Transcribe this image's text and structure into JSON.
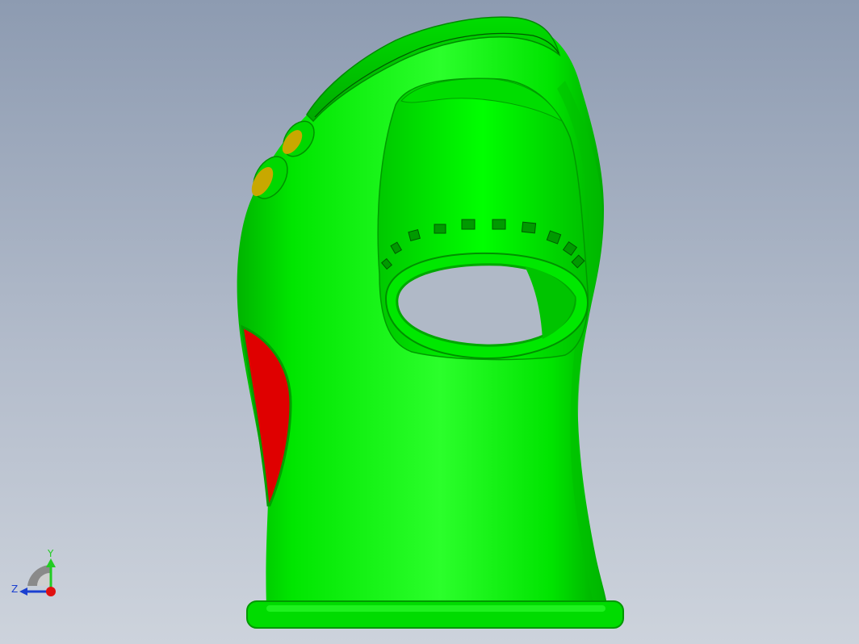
{
  "viewport": {
    "background_top": "#8d9bb1",
    "background_bottom": "#cdd3dc"
  },
  "model": {
    "body_color": "#00ee00",
    "shadow_color": "#00a800",
    "highlight_color": "#6bff6b",
    "accent_color": "#e00000",
    "button_color": "#c8a800",
    "hole_color": "#b0b9c7"
  },
  "triad": {
    "y_label": "Y",
    "z_label": "Z",
    "y_color": "#22cc22",
    "z_color": "#1a3fd0",
    "origin_color": "#e01010"
  }
}
